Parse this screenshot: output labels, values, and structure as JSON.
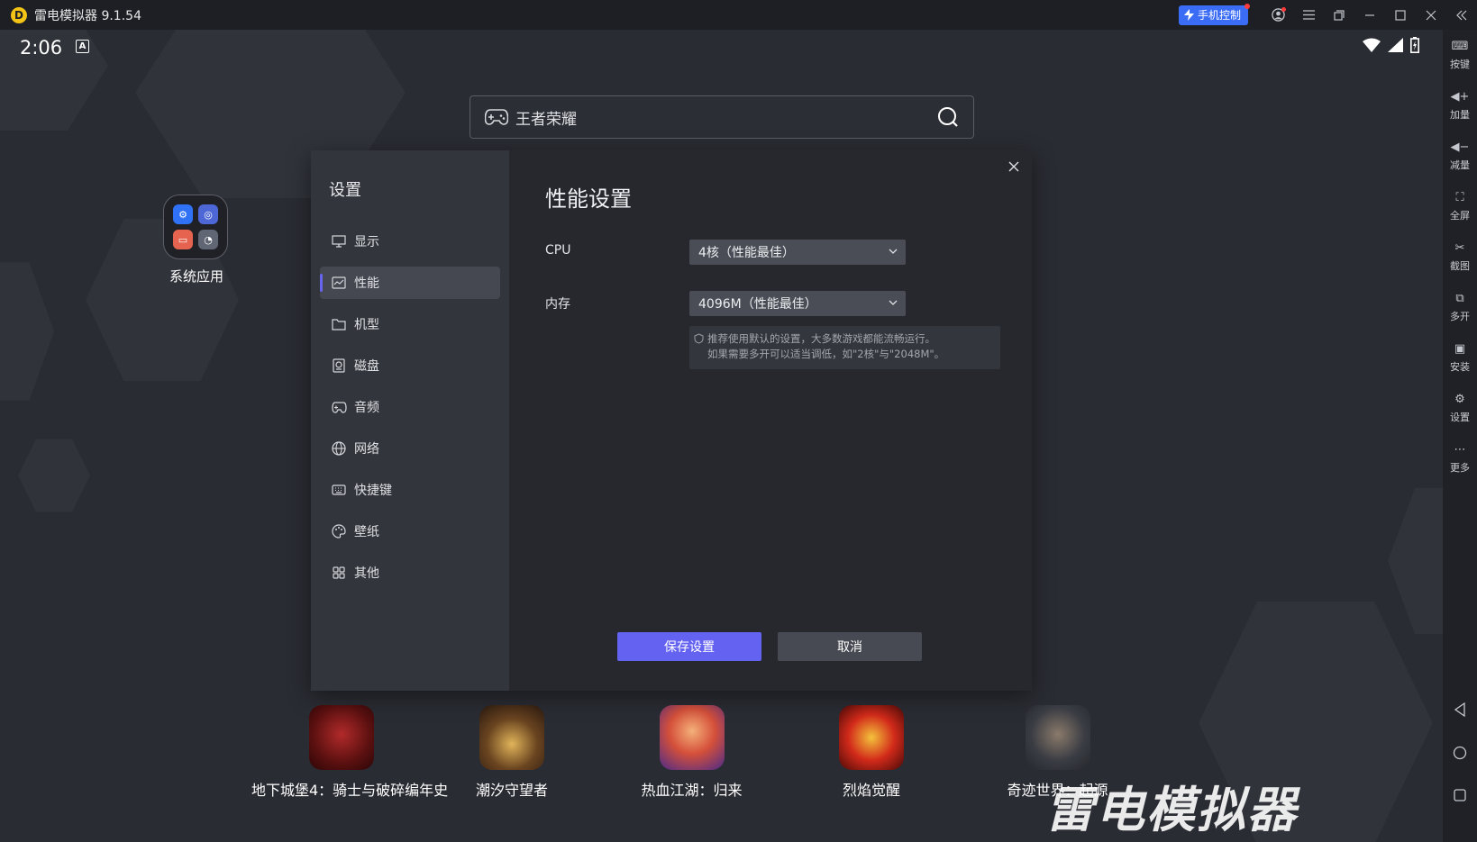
{
  "titlebar": {
    "app_name": "雷电模拟器 9.1.54",
    "phone_control_label": "手机控制"
  },
  "status_bar": {
    "time": "2:06",
    "keyboard_badge": "A"
  },
  "search": {
    "placeholder": "王者荣耀"
  },
  "desktop": {
    "system_apps_label": "系统应用"
  },
  "bottom_apps": [
    {
      "label": "地下城堡4：骑士与破碎编年史"
    },
    {
      "label": "潮汐守望者"
    },
    {
      "label": "热血江湖：归来"
    },
    {
      "label": "烈焰觉醒"
    },
    {
      "label": "奇迹世界：起源"
    }
  ],
  "watermark": "雷电模拟器",
  "right_sidebar": {
    "items": [
      {
        "label": "按键"
      },
      {
        "label": "加量"
      },
      {
        "label": "减量"
      },
      {
        "label": "全屏"
      },
      {
        "label": "截图"
      },
      {
        "label": "多开"
      },
      {
        "label": "安装"
      },
      {
        "label": "设置"
      },
      {
        "label": "更多"
      }
    ]
  },
  "settings": {
    "sidebar_title": "设置",
    "nav": [
      {
        "label": "显示",
        "icon": "monitor-icon"
      },
      {
        "label": "性能",
        "icon": "performance-icon",
        "active": true
      },
      {
        "label": "机型",
        "icon": "folder-icon"
      },
      {
        "label": "磁盘",
        "icon": "disk-icon"
      },
      {
        "label": "音频",
        "icon": "gamepad-icon"
      },
      {
        "label": "网络",
        "icon": "globe-icon"
      },
      {
        "label": "快捷键",
        "icon": "keyboard-icon"
      },
      {
        "label": "壁纸",
        "icon": "palette-icon"
      },
      {
        "label": "其他",
        "icon": "grid-icon"
      }
    ],
    "title": "性能设置",
    "cpu_label": "CPU",
    "cpu_value": "4核（性能最佳）",
    "memory_label": "内存",
    "memory_value": "4096M（性能最佳）",
    "hint_line1": "推荐使用默认的设置，大多数游戏都能流畅运行。",
    "hint_line2": "如果需要多开可以适当调低，如\"2核\"与\"2048M\"。",
    "save_label": "保存设置",
    "cancel_label": "取消"
  },
  "colors": {
    "accent": "#6462f0",
    "phone_control": "#3b6cf6",
    "logo": "#f3c316"
  }
}
